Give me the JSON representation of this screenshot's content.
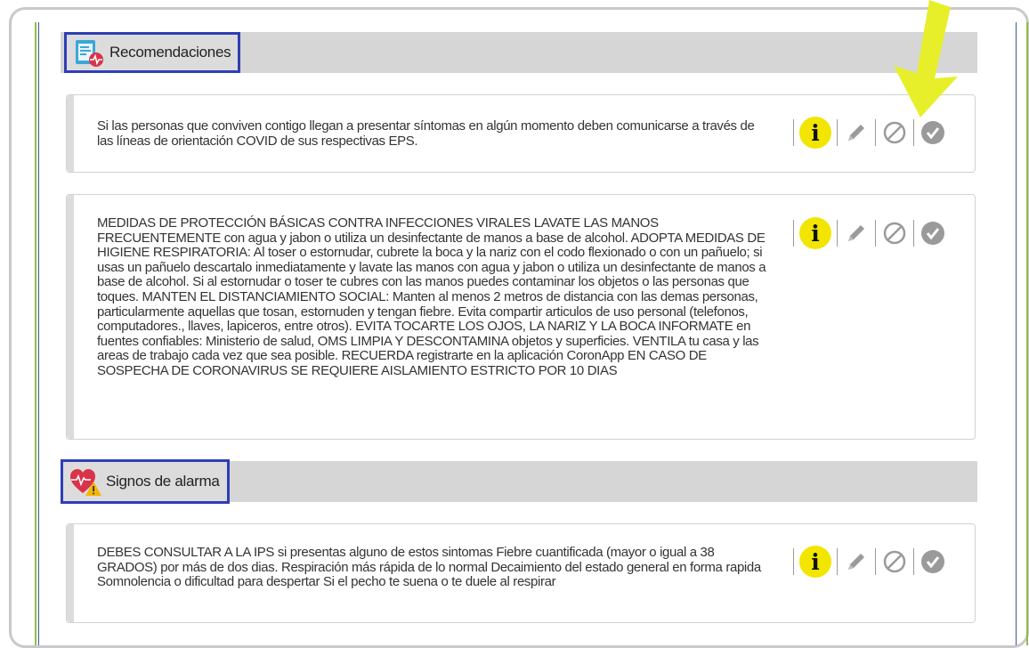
{
  "sections": {
    "recomendaciones": {
      "title": "Recomendaciones",
      "icon": "medical-record-icon"
    },
    "signos": {
      "title": "Signos de alarma",
      "icon": "heart-warning-icon"
    }
  },
  "cards": [
    {
      "text": "Si las personas que conviven contigo llegan a presentar síntomas en algún momento deben comunicarse a través de las líneas de orientación COVID de sus respectivas EPS."
    },
    {
      "text": "MEDIDAS DE PROTECCIÓN BÁSICAS CONTRA INFECCIONES VIRALES LAVATE LAS MANOS FRECUENTEMENTE con agua y jabon o utiliza un desinfectante de manos a base de alcohol. ADOPTA MEDIDAS DE HIGIENE RESPIRATORIA: Al toser o estornudar, cubrete la boca y la nariz con el codo flexionado o con un pañuelo; si usas un pañuelo descartalo inmediatamente y lavate las manos con agua y jabon o utiliza un desinfectante de manos a base de alcohol. Si al estornudar o toser te cubres con las manos puedes contaminar los objetos o las personas que toques. MANTEN EL DISTANCIAMIENTO SOCIAL: Manten al menos 2 metros de distancia con las demas personas, particularmente aquellas que tosan, estornuden y tengan fiebre. Evita compartir articulos de uso personal (telefonos, computadores., llaves, lapiceros, entre otros). EVITA TOCARTE LOS OJOS, LA NARIZ Y LA BOCA INFORMATE en fuentes confiables: Ministerio de salud, OMS LIMPIA Y DESCONTAMINA objetos y superficies. VENTILA tu casa y las areas de trabajo cada vez que sea posible. RECUERDA registrarte en la aplicación CoronApp EN CASO DE SOSPECHA DE CORONAVIRUS SE REQUIERE AISLAMIENTO ESTRICTO POR 10 DIAS"
    },
    {
      "text": "DEBES CONSULTAR A LA IPS si presentas alguno de estos sintomas Fiebre cuantificada (mayor o igual a 38 GRADOS) por más de dos dias. Respiración más rápida de lo normal Decaimiento del estado general en forma rapida Somnolencia o dificultad para despertar Si el pecho te suena o te duele al respirar"
    }
  ],
  "actions": {
    "info": "i",
    "icons": [
      "info-icon",
      "pencil-icon",
      "block-icon",
      "check-circle-icon"
    ]
  },
  "colors": {
    "info_yellow": "#f2e600",
    "arrow_yellow": "#e6ef2a",
    "header_gray": "#d6d6d6",
    "title_border": "#2f3eb5",
    "green_line": "#8cbf4a",
    "blue_line": "#3c5a9a",
    "icon_gray": "#9a9a9a"
  }
}
